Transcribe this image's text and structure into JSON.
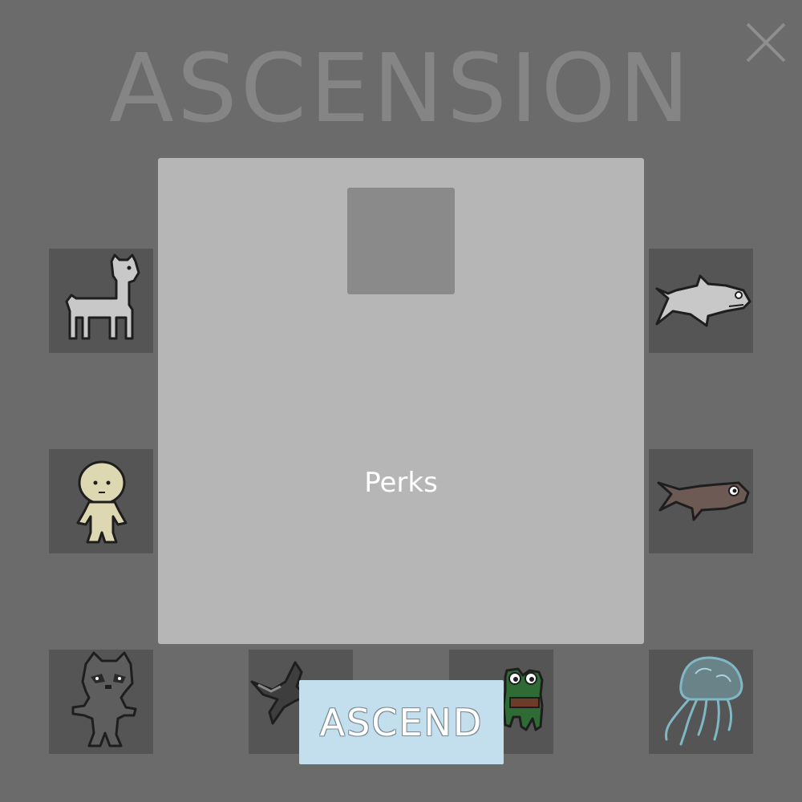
{
  "screen": {
    "title": "ASCENSION",
    "close_icon": "close-icon"
  },
  "panel": {
    "label": "Perks"
  },
  "characters": [
    {
      "id": "llama",
      "icon": "llama-icon"
    },
    {
      "id": "shark",
      "icon": "shark-icon"
    },
    {
      "id": "blob-person",
      "icon": "blob-person-icon"
    },
    {
      "id": "brown-fish",
      "icon": "brown-fish-icon"
    },
    {
      "id": "raccoon",
      "icon": "raccoon-icon"
    },
    {
      "id": "bird",
      "icon": "bird-icon"
    },
    {
      "id": "frog",
      "icon": "frog-icon"
    },
    {
      "id": "jellyfish",
      "icon": "jellyfish-icon"
    }
  ],
  "actions": {
    "ascend_label": "ASCEND"
  },
  "colors": {
    "background": "#6b6b6b",
    "panel": "#b6b6b6",
    "slot": "#555555",
    "ascend_button": "#c3dfee",
    "jellyfish": "#7fb8c4",
    "frog": "#2f6b35"
  }
}
